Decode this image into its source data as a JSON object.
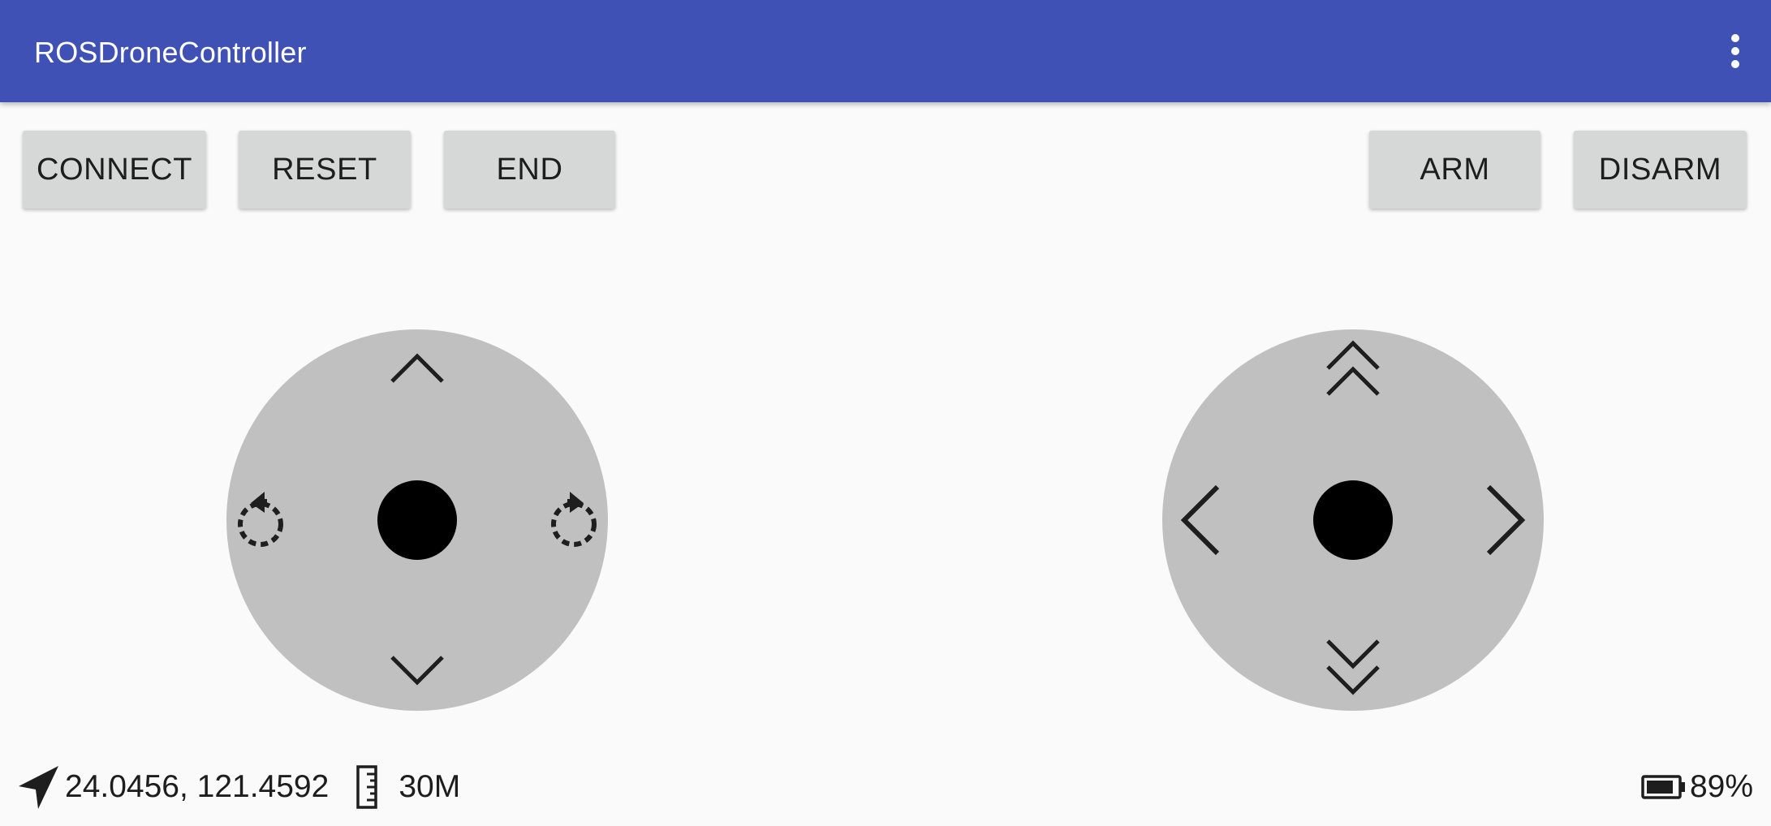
{
  "app": {
    "title": "ROSDroneController",
    "colors": {
      "appbar": "#3f51b5",
      "background": "#fafafa",
      "button": "#d6d7d7",
      "joystick": "#c0c0c0",
      "knob": "#000000"
    }
  },
  "toolbar": {
    "overflow_icon": "more-vert-icon"
  },
  "buttons": {
    "connect": "CONNECT",
    "reset": "RESET",
    "end": "END",
    "arm": "ARM",
    "disarm": "DISARM"
  },
  "joysticks": {
    "left": {
      "icons": [
        "chevron-up-icon",
        "chevron-down-icon",
        "rotate-left-icon",
        "rotate-right-icon"
      ]
    },
    "right": {
      "icons": [
        "double-chevron-up-icon",
        "double-chevron-down-icon",
        "chevron-left-icon",
        "chevron-right-icon"
      ]
    }
  },
  "status": {
    "location_icon": "navigation-arrow-icon",
    "coordinates": "24.0456, 121.4592",
    "altitude_icon": "ruler-icon",
    "altitude": "30M",
    "battery_icon": "battery-icon",
    "battery_level": 0.89,
    "battery": "89%"
  }
}
